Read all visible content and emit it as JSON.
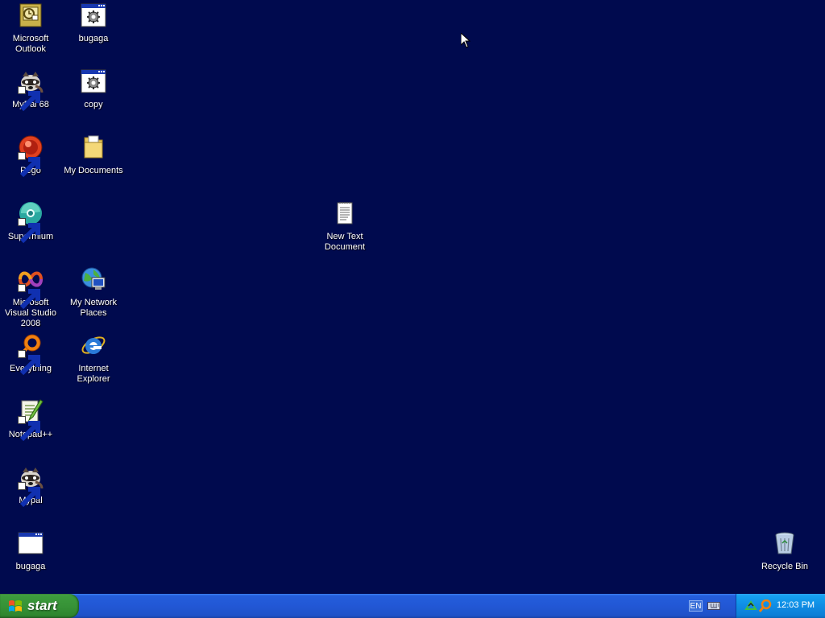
{
  "desktop": {
    "background_color": "#000a4e",
    "icons": {
      "outlook": "Microsoft Outlook",
      "bugaga_top": "bugaga",
      "mypal68": "MyPal 68",
      "copy": "copy",
      "pego": "Pego",
      "my_documents": "My Documents",
      "supermium": "Supermium",
      "new_text_document": "New Text Document",
      "visual_studio": "Microsoft Visual Studio 2008",
      "my_network_places": "My Network Places",
      "everything": "Everything",
      "internet_explorer": "Internet Explorer",
      "notepadpp": "Notepad++",
      "mypal": "Mypal",
      "bugaga_bottom": "bugaga",
      "recycle_bin": "Recycle Bin"
    }
  },
  "taskbar": {
    "start_label": "start",
    "language": "EN",
    "clock": "12:03 PM"
  }
}
